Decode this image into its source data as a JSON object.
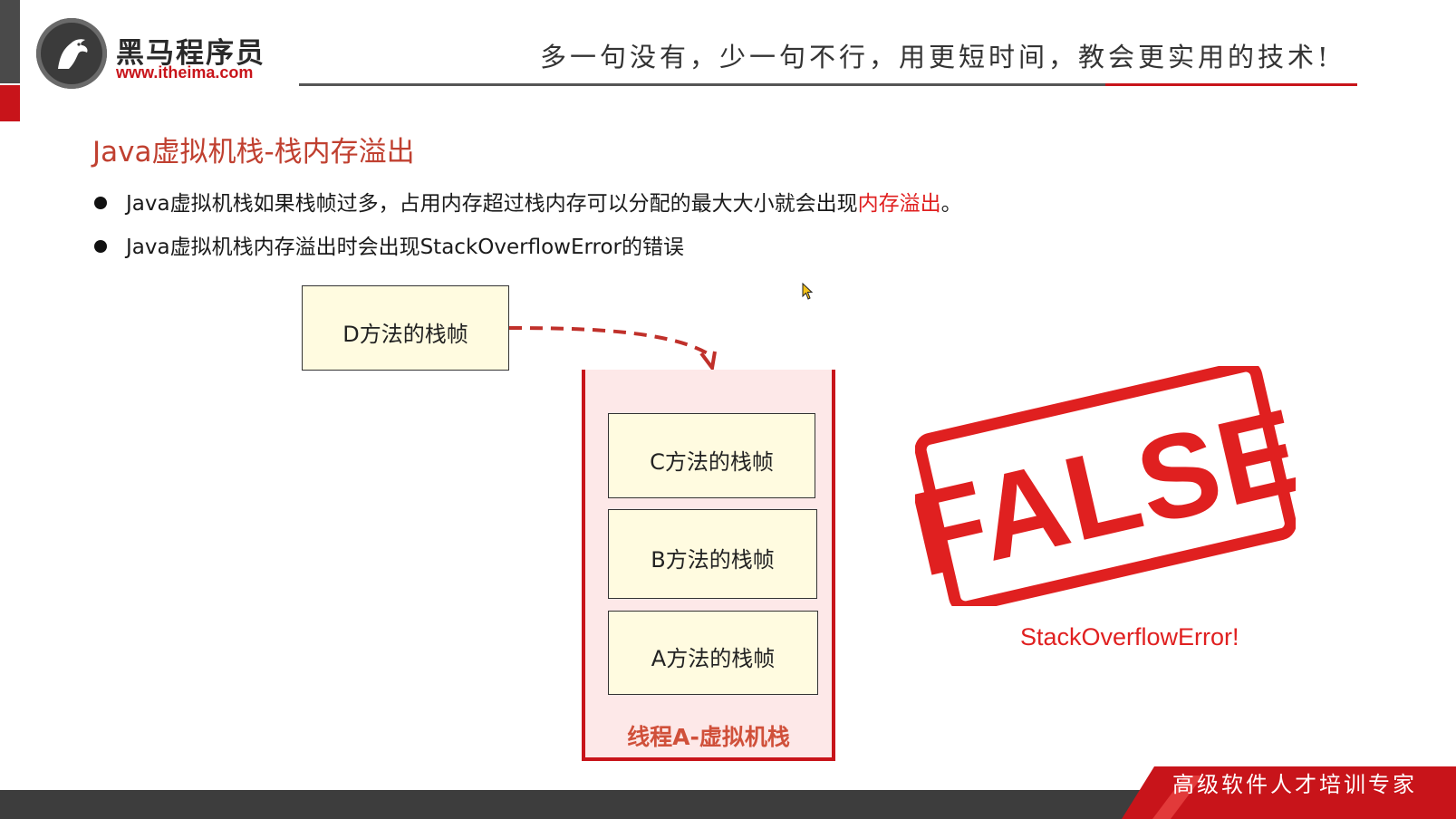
{
  "header": {
    "brand_name": "黑马程序员",
    "brand_url": "www.itheima.com",
    "slogan": "多一句没有，少一句不行，用更短时间，教会更实用的技术!"
  },
  "slide": {
    "title": "Java虚拟机栈-栈内存溢出",
    "bullets": [
      {
        "text_before": "Java虚拟机栈如果栈帧过多，占用内存超过栈内存可以分配的最大大小就会出现",
        "highlight": "内存溢出",
        "text_after": "。"
      },
      {
        "text_before": "Java虚拟机栈内存溢出时会出现StackOverflowError的错误",
        "highlight": "",
        "text_after": ""
      }
    ]
  },
  "diagram": {
    "incoming_frame": "D方法的栈帧",
    "stack_frames": [
      "C方法的栈帧",
      "B方法的栈帧",
      "A方法的栈帧"
    ],
    "stack_label": "线程A-虚拟机栈"
  },
  "stamp": {
    "word": "FALSE",
    "error_message": "StackOverflowError!",
    "color": "#e02020"
  },
  "footer": {
    "tagline": "高级软件人才培训专家"
  },
  "colors": {
    "brand_red": "#c8141a",
    "title_red": "#c04030",
    "frame_fill": "#fffbe0",
    "stack_fill": "#fde8e8"
  }
}
